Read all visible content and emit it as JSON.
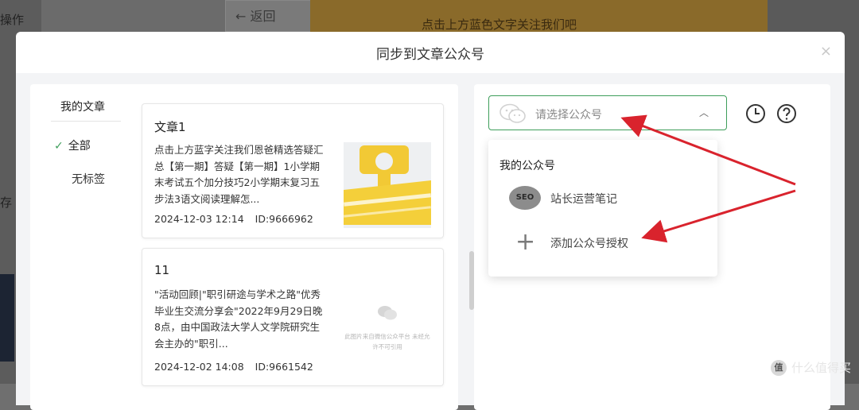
{
  "background": {
    "left_texts": [
      "操作",
      "存"
    ],
    "back_button": "← 返回",
    "banner_text": "点击上方蓝色文字关注我们吧",
    "watermark": "什么值得买",
    "watermark_icon": "值"
  },
  "dialog": {
    "title": "同步到文章公众号",
    "close_icon": "×"
  },
  "categories": {
    "title": "我的文章",
    "items": [
      {
        "label": "全部",
        "selected": true
      },
      {
        "label": "无标签",
        "selected": false
      }
    ]
  },
  "articles": [
    {
      "title": "文章1",
      "summary": "点击上方蓝字关注我们恩爸精选答疑汇总【第一期】答疑【第一期】1小学期末考试五个加分技巧2小学期末复习五步法3语文阅读理解怎...",
      "date": "2024-12-03 12:14",
      "id": "ID:9666962",
      "thumb": "clip-image"
    },
    {
      "title": "11",
      "summary": "\"活动回顾|\"职引研途与学术之路\"优秀毕业生交流分享会\"2022年9月29日晚8点，由中国政法大学人文学院研究生会主办的\"职引...",
      "date": "2024-12-02 14:08",
      "id": "ID:9661542",
      "thumb_tip": "此图片来自微信公众平台 未经允许不可引用"
    }
  ],
  "account_select": {
    "placeholder": "请选择公众号",
    "icons": [
      "wechat-icon",
      "chevron-up-icon",
      "clock-icon",
      "help-icon"
    ]
  },
  "dropdown": {
    "title": "我的公众号",
    "items": [
      {
        "label": "站长运营笔记",
        "avatar_text": "SEO"
      },
      {
        "label": "添加公众号授权",
        "icon": "+"
      }
    ]
  },
  "colors": {
    "accent_green": "#3e9e5b",
    "arrow_red": "#d9232d",
    "clip_yellow": "#f4cf3a"
  }
}
